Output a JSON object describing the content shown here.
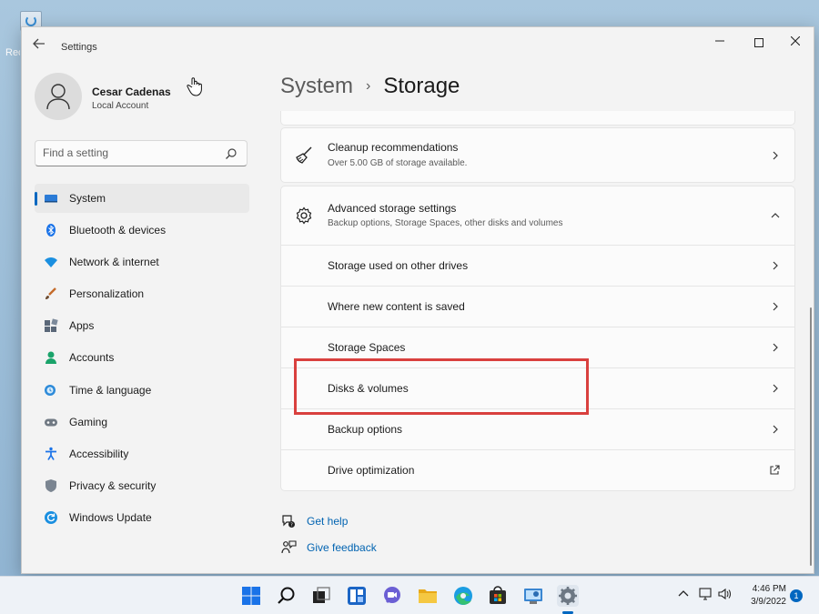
{
  "desktop": {
    "recycle_label": "Rec"
  },
  "window": {
    "title": "Settings",
    "controls": {
      "minimize": "—",
      "close": "✕"
    }
  },
  "profile": {
    "name": "Cesar Cadenas",
    "account_type": "Local Account"
  },
  "search": {
    "placeholder": "Find a setting"
  },
  "nav": {
    "items": [
      {
        "label": "System",
        "icon": "monitor-icon",
        "active": true
      },
      {
        "label": "Bluetooth & devices",
        "icon": "bluetooth-icon"
      },
      {
        "label": "Network & internet",
        "icon": "wifi-icon"
      },
      {
        "label": "Personalization",
        "icon": "brush-icon"
      },
      {
        "label": "Apps",
        "icon": "apps-icon"
      },
      {
        "label": "Accounts",
        "icon": "person-icon"
      },
      {
        "label": "Time & language",
        "icon": "globe-clock-icon"
      },
      {
        "label": "Gaming",
        "icon": "gamepad-icon"
      },
      {
        "label": "Accessibility",
        "icon": "accessibility-icon"
      },
      {
        "label": "Privacy & security",
        "icon": "shield-icon"
      },
      {
        "label": "Windows Update",
        "icon": "update-icon"
      }
    ]
  },
  "breadcrumb": {
    "parent": "System",
    "separator": "›",
    "current": "Storage"
  },
  "cleanup": {
    "title": "Cleanup recommendations",
    "subtitle": "Over 5.00 GB of storage available."
  },
  "advanced": {
    "title": "Advanced storage settings",
    "subtitle": "Backup options, Storage Spaces, other disks and volumes",
    "rows": [
      {
        "label": "Storage used on other drives"
      },
      {
        "label": "Where new content is saved"
      },
      {
        "label": "Storage Spaces"
      },
      {
        "label": "Disks & volumes",
        "highlighted": true
      },
      {
        "label": "Backup options"
      },
      {
        "label": "Drive optimization",
        "external": true
      }
    ]
  },
  "help": {
    "get_help": "Get help",
    "give_feedback": "Give feedback"
  },
  "taskbar": {
    "apps": [
      "start-icon",
      "search-icon",
      "task-view-icon",
      "widgets-icon",
      "chat-icon",
      "file-explorer-icon",
      "edge-icon",
      "store-icon",
      "control-panel-icon",
      "settings-icon"
    ],
    "clock": {
      "time": "4:46 PM",
      "date": "3/9/2022"
    },
    "notification_count": "1",
    "tray_chevron": "^"
  },
  "colors": {
    "accent": "#0067c0",
    "highlight_box": "#d9403e",
    "link": "#0063b1"
  }
}
